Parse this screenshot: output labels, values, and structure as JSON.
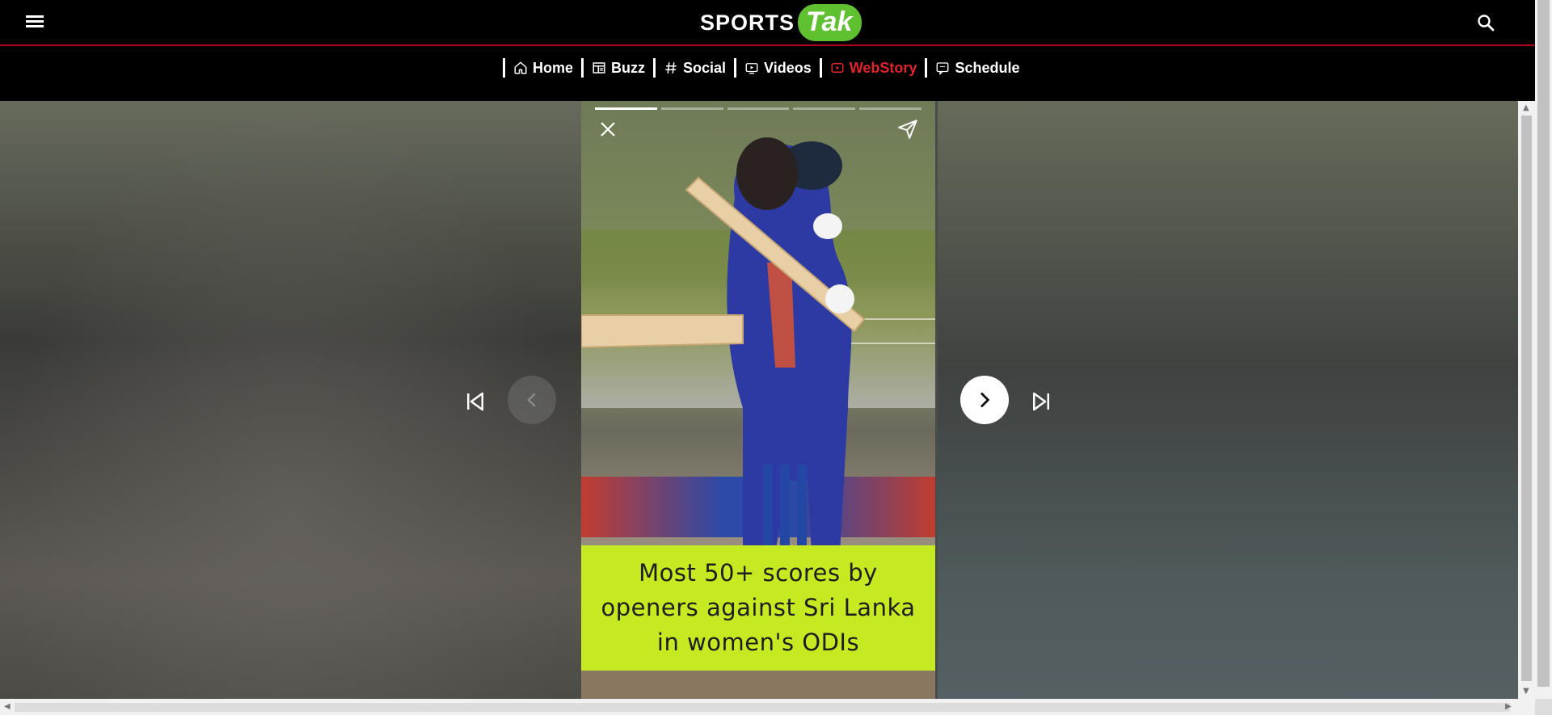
{
  "header": {
    "logo_sports": "SPORTS",
    "logo_tak": "Tak",
    "brand_color": "#5fc12f",
    "accent_color": "#e0222a"
  },
  "nav": {
    "items": [
      {
        "label": "Home",
        "icon": "home-icon"
      },
      {
        "label": "Buzz",
        "icon": "newspaper-icon"
      },
      {
        "label": "Social",
        "icon": "hash-icon"
      },
      {
        "label": "Videos",
        "icon": "video-icon"
      },
      {
        "label": "WebStory",
        "icon": "play-icon",
        "active": true
      },
      {
        "label": "Schedule",
        "icon": "calendar-icon"
      }
    ]
  },
  "story": {
    "caption": "Most 50+ scores by openers against Sri Lanka in women's ODIs",
    "caption_bg": "#c6ea21",
    "progress_total": 5,
    "progress_current": 1
  }
}
